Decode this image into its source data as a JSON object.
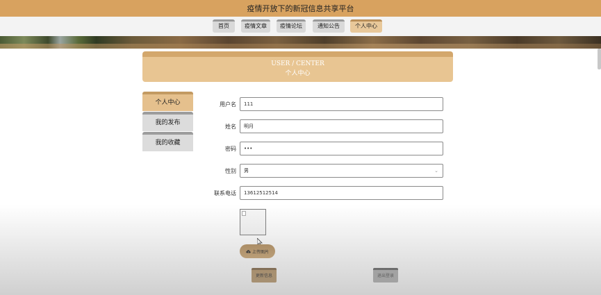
{
  "site": {
    "title": "疫情开放下的新冠信息共享平台"
  },
  "nav": {
    "items": [
      {
        "label": "首页"
      },
      {
        "label": "疫情文章"
      },
      {
        "label": "疫情论坛"
      },
      {
        "label": "通知公告"
      },
      {
        "label": "个人中心",
        "active": true
      }
    ]
  },
  "header": {
    "title_en": "USER / CENTER",
    "title_cn": "个人中心"
  },
  "sidebar": {
    "items": [
      {
        "label": "个人中心",
        "active": true
      },
      {
        "label": "我的发布"
      },
      {
        "label": "我的收藏"
      }
    ]
  },
  "form": {
    "username": {
      "label": "用户名",
      "value": "111"
    },
    "name": {
      "label": "姓名",
      "value": "明月"
    },
    "password": {
      "label": "密码",
      "value": "•••"
    },
    "gender": {
      "label": "性别",
      "value": "男"
    },
    "phone": {
      "label": "联系电话",
      "value": "13612512514"
    }
  },
  "avatar": {
    "upload_label": "上传图片"
  },
  "actions": {
    "update_label": "更新信息",
    "logout_label": "退出登录"
  },
  "colors": {
    "accent": "#d8a25f",
    "accent_light": "#e8c592",
    "inactive": "#d9d9d9"
  }
}
